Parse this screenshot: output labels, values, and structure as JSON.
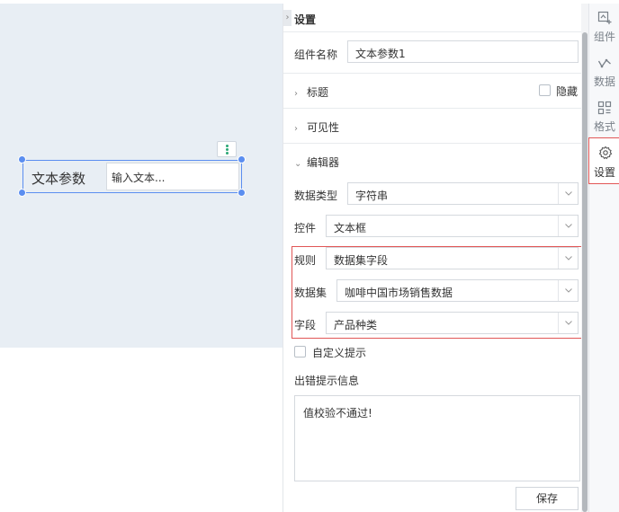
{
  "canvas": {
    "widget_label": "文本参数",
    "widget_input_placeholder": "输入文本..."
  },
  "panel": {
    "title": "设置",
    "component_name_label": "组件名称",
    "component_name_value": "文本参数1",
    "sections": {
      "title_label": "标题",
      "hide_label": "隐藏",
      "visibility_label": "可见性",
      "editor_label": "编辑器"
    },
    "data_type_label": "数据类型",
    "data_type_value": "字符串",
    "control_label": "控件",
    "control_value": "文本框",
    "rule_label": "规则",
    "rule_value": "数据集字段",
    "dataset_label": "数据集",
    "dataset_value": "咖啡中国市场销售数据",
    "field_label": "字段",
    "field_value": "产品种类",
    "custom_hint_label": "自定义提示",
    "error_info_label": "出错提示信息",
    "error_message": "值校验不通过!",
    "save_label": "保存"
  },
  "side_tabs": [
    {
      "label": "组件",
      "icon": "component-icon",
      "active": false
    },
    {
      "label": "数据",
      "icon": "data-icon",
      "active": false
    },
    {
      "label": "格式",
      "icon": "format-icon",
      "active": false
    },
    {
      "label": "设置",
      "icon": "gear-icon",
      "active": true
    }
  ],
  "colors": {
    "accent": "#5b8ef0",
    "highlight_border": "#e15656",
    "canvas_bg": "#e8eef4",
    "kebab_green": "#2aa876"
  }
}
